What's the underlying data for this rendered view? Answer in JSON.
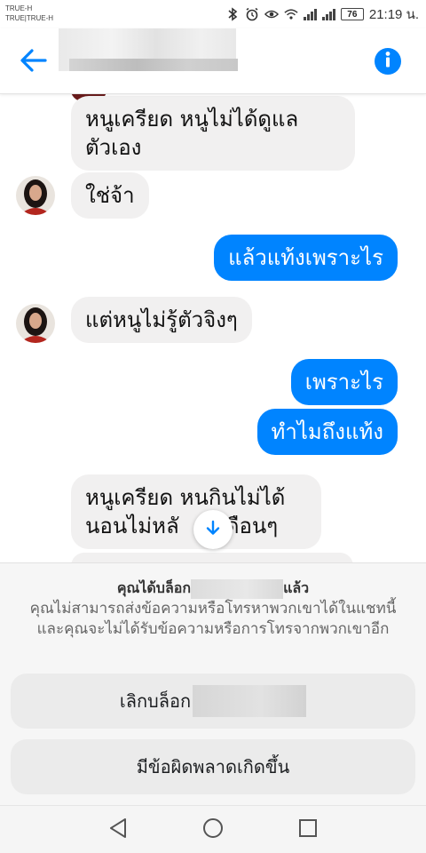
{
  "status_bar": {
    "carrier_line1": "TRUE-H",
    "carrier_line2": "TRUE|TRUE-H",
    "battery": "76",
    "time": "21:19 น."
  },
  "header": {
    "back_icon": "arrow-left-icon",
    "info_icon": "info-circle-icon",
    "accent_color": "#0084ff"
  },
  "messages": [
    {
      "id": "m1",
      "direction": "in",
      "lines": [
        "หนูเครียด หนูไม่ได้ดูแล",
        "ตัวเอง"
      ]
    },
    {
      "id": "m2",
      "direction": "in",
      "lines": [
        "ใช่จ้า"
      ]
    },
    {
      "id": "m3",
      "direction": "out",
      "lines": [
        "แล้วแท้งเพราะไร"
      ]
    },
    {
      "id": "m4",
      "direction": "in",
      "lines": [
        "แต่หนูไม่รู้ตัวจิงๆ"
      ]
    },
    {
      "id": "m5",
      "direction": "out",
      "lines": [
        "เพราะไร"
      ]
    },
    {
      "id": "m6",
      "direction": "out",
      "lines": [
        "ทำไมถึงแท้ง"
      ]
    },
    {
      "id": "m7",
      "direction": "in",
      "lines": [
        "หนูเครียด หนกินไม่ได้",
        "นอนไม่หลั",
        "เดือนๆ"
      ]
    }
  ],
  "blocked_panel": {
    "title_prefix": "คุณได้บล็อก",
    "title_suffix": "แล้ว",
    "description": "คุณไม่สามารถส่งข้อความหรือโทรหาพวกเขาได้ในแชทนี้ และคุณจะไม่ได้รับข้อความหรือการโทรจากพวกเขาอีก",
    "unblock_label": "เลิกบล็อก",
    "error_label": "มีข้อผิดพลาดเกิดขึ้น"
  },
  "colors": {
    "outgoing_bubble": "#0084ff",
    "incoming_bubble": "#f1f0f0",
    "panel_bg": "#f6f6f6",
    "button_bg": "#ebebeb"
  },
  "nav": {
    "back_icon": "triangle-back-icon",
    "home_icon": "circle-home-icon",
    "recents_icon": "square-recents-icon"
  }
}
